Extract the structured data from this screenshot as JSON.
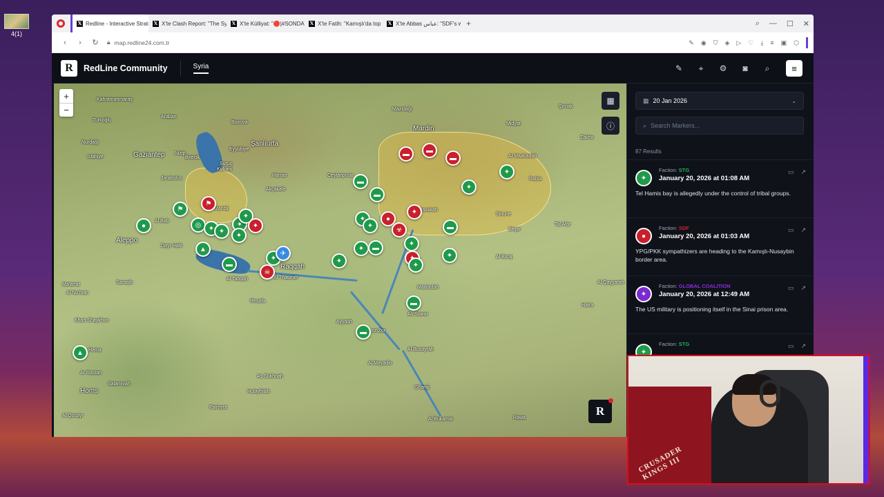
{
  "desktop": {
    "icon_label": "4(1)"
  },
  "browser": {
    "tabs": [
      {
        "label": "Redline - Interactive Strate",
        "active": true
      },
      {
        "label": "X'te Clash Report: \"The Sy"
      },
      {
        "label": "X'te Külliyat: \"🔴|#SONDA"
      },
      {
        "label": "X'te Fatih: \"Kamışlı'da top"
      },
      {
        "label": "X'te Abbas عباس: \"SDF's w"
      }
    ],
    "new_tab": "+",
    "url": "map.redline24.com.tr"
  },
  "app": {
    "brand": "RedLine Community",
    "region_tab": "Syria",
    "logo_letter": "R"
  },
  "map": {
    "zoom_in": "+",
    "zoom_out": "−",
    "labels": [
      {
        "t": "Kahramanmaraş",
        "c": "lbl-kahraman"
      },
      {
        "t": "Gaziantep",
        "c": "lbl-gaziantep",
        "big": true
      },
      {
        "t": "Şanlıurfa",
        "c": "lbl-sanliurfa",
        "big": true
      },
      {
        "t": "Mardin",
        "c": "lbl-mardin",
        "big": true
      },
      {
        "t": "Aleppo",
        "c": "lbl-aleppo",
        "big": true
      },
      {
        "t": "Raqqah",
        "c": "lbl-raqqah"
      },
      {
        "t": "Homs",
        "c": "lbl-homs",
        "big": true
      },
      {
        "t": "Hama",
        "c": "lbl-hama"
      },
      {
        "t": "Palmyra",
        "c": "lbl-palmyra"
      },
      {
        "t": "Şırnak",
        "c": "lbl-sirnak"
      },
      {
        "t": "Zakho",
        "c": "lbl-zakho"
      },
      {
        "t": "Turkoğlu",
        "c": "lbl-turkoglu"
      },
      {
        "t": "Nurdağı",
        "c": "lbl-nurdagi"
      },
      {
        "t": "Islahiye",
        "c": "lbl-islahiye"
      },
      {
        "t": "Nizip",
        "c": "lbl-nizip"
      },
      {
        "t": "Birecik",
        "c": "lbl-birecik"
      },
      {
        "t": "Suruç",
        "c": "lbl-suruc"
      },
      {
        "t": "Kobani",
        "c": "lbl-kobani"
      },
      {
        "t": "Harran",
        "c": "lbl-harran"
      },
      {
        "t": "Akçakale",
        "c": "lbl-akcakale"
      },
      {
        "t": "Ceylanpınar",
        "c": "lbl-ceylanpinar"
      },
      {
        "t": "Eyyübiye",
        "c": "lbl-eyyubiye"
      },
      {
        "t": "Bozova",
        "c": "lbl-bozova"
      },
      {
        "t": "Araban",
        "c": "lbl-araban"
      },
      {
        "t": "Mazıdağı",
        "c": "lbl-mazidagi"
      },
      {
        "t": "Midyat",
        "c": "lbl-midyat"
      },
      {
        "t": "Al Hasakah",
        "c": "lbl-hasakah"
      },
      {
        "t": "Al Maabadah",
        "c": "lbl-maabadah"
      },
      {
        "t": "Rabia",
        "c": "lbl-rabia"
      },
      {
        "t": "Sinune",
        "c": "lbl-sinune"
      },
      {
        "t": "Sinjar",
        "c": "lbl-sinjar"
      },
      {
        "t": "Tal Afar",
        "c": "lbl-talafar"
      },
      {
        "t": "Al Ba'aj",
        "c": "lbl-albaaj"
      },
      {
        "t": "Al Qayyarah",
        "c": "lbl-qayyarah"
      },
      {
        "t": "Hatra",
        "c": "lbl-hatra"
      },
      {
        "t": "Al Tabqah",
        "c": "lbl-tabqah"
      },
      {
        "t": "Resafa",
        "c": "lbl-resafa"
      },
      {
        "t": "Al Thawrah",
        "c": "lbl-thawrah"
      },
      {
        "t": "Deir ez-Zor",
        "c": "lbl-deir"
      },
      {
        "t": "Al Mayadin",
        "c": "lbl-mayadin"
      },
      {
        "t": "Al Busayrah",
        "c": "lbl-busayrah"
      },
      {
        "t": "Markadah",
        "c": "lbl-markadah"
      },
      {
        "t": "As Suwar",
        "c": "lbl-suwar"
      },
      {
        "t": "Al Bukamal",
        "c": "lbl-bukamal"
      },
      {
        "t": "Ghaniji",
        "c": "lbl-ghaniji"
      },
      {
        "t": "Rawa",
        "c": "lbl-rawa"
      },
      {
        "t": "As Sukhnah",
        "c": "lbl-sukhnah"
      },
      {
        "t": "Hulayhilah",
        "c": "lbl-hulayhilah"
      },
      {
        "t": "Al Qusayr",
        "c": "lbl-qusayr"
      },
      {
        "t": "Ar Rastan",
        "c": "lbl-rastan"
      },
      {
        "t": "Salamiyah",
        "c": "lbl-salamiyah"
      },
      {
        "t": "Khan Shaykhun",
        "c": "lbl-khan"
      },
      {
        "t": "Al Nu'man",
        "c": "lbl-numan"
      },
      {
        "t": "Saraqib",
        "c": "lbl-saraqib"
      },
      {
        "t": "Ma'arrat",
        "c": "lbl-maarrat"
      },
      {
        "t": "Jarabulus",
        "c": "lbl-jarabulus"
      },
      {
        "t": "Al Bab",
        "c": "lbl-albab"
      },
      {
        "t": "Dayr Hafir",
        "c": "lbl-dayrhafir"
      },
      {
        "t": "Manbij",
        "c": "lbl-manbij"
      },
      {
        "t": "Ayyash",
        "c": "lbl-ayyash"
      }
    ]
  },
  "sidebar": {
    "date": "20 Jan 2026",
    "search_placeholder": "Search Markers...",
    "results": "87 Results",
    "items": [
      {
        "faction_label": "Faction:",
        "faction": "STG",
        "faction_color": "#22b455",
        "avatar_color": "#1f9a4a",
        "time": "January 20, 2026 at 01:08 AM",
        "text": "Tel Hamis bay is allegedly under the control of tribal groups."
      },
      {
        "faction_label": "Faction:",
        "faction": "SDF",
        "faction_color": "#d0202c",
        "avatar_color": "#c8202c",
        "time": "January 20, 2026 at 01:03 AM",
        "text": "YPG/PKK sympathizers are heading to the Kamışlı-Nusaybin border area."
      },
      {
        "faction_label": "Faction:",
        "faction": "GLOBAL COALITION",
        "faction_color": "#8a2be2",
        "avatar_color": "#7b2ad0",
        "time": "January 20, 2026 at 12:49 AM",
        "text": "The US military is positioning itself in the Sinai prison area."
      },
      {
        "faction_label": "Faction:",
        "faction": "STG",
        "faction_color": "#22b455",
        "avatar_color": "#1f9a4a",
        "time": "",
        "text": ""
      }
    ]
  },
  "webcam": {
    "blanket_text": "CRUSADER KINGS III"
  }
}
